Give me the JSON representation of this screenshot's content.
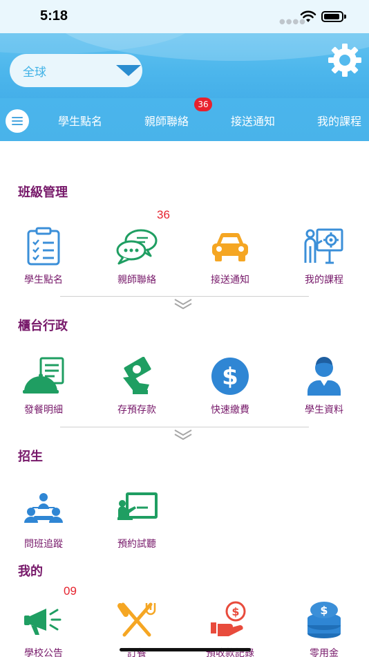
{
  "status": {
    "time": "5:18"
  },
  "header": {
    "region": "全球"
  },
  "nav": {
    "items": [
      "學生點名",
      "親師聯絡",
      "接送通知",
      "我的課程"
    ],
    "badge": "36"
  },
  "sections": [
    {
      "title": "班級管理",
      "tiles": [
        {
          "label": "學生點名",
          "icon": "clipboard-checklist-icon"
        },
        {
          "label": "親師聯絡",
          "icon": "chat-bubbles-icon",
          "count": "36"
        },
        {
          "label": "接送通知",
          "icon": "car-icon"
        },
        {
          "label": "我的課程",
          "icon": "teacher-board-icon"
        }
      ]
    },
    {
      "title": "櫃台行政",
      "tiles": [
        {
          "label": "發餐明細",
          "icon": "food-cloche-icon"
        },
        {
          "label": "存預存款",
          "icon": "money-deposit-icon"
        },
        {
          "label": "快速繳費",
          "icon": "dollar-coin-icon"
        },
        {
          "label": "學生資料",
          "icon": "student-profile-icon"
        }
      ]
    },
    {
      "title": "招生",
      "tiles": [
        {
          "label": "問班追蹤",
          "icon": "group-meeting-icon"
        },
        {
          "label": "預約試聽",
          "icon": "classroom-board-icon"
        }
      ]
    },
    {
      "title": "我的",
      "tiles": [
        {
          "label": "學校公告",
          "icon": "megaphone-icon",
          "count": "09"
        },
        {
          "label": "訂餐",
          "icon": "fork-knife-icon"
        },
        {
          "label": "預收款記錄",
          "icon": "payment-hand-icon"
        },
        {
          "label": "零用金",
          "icon": "coin-stack-icon"
        }
      ]
    }
  ],
  "colors": {
    "brand_blue": "#49b3ea",
    "section_title": "#77196a",
    "badge_red": "#e8212d",
    "icon_blue": "#3b8fd8",
    "icon_green": "#1f9e62",
    "icon_orange": "#f5a623"
  }
}
